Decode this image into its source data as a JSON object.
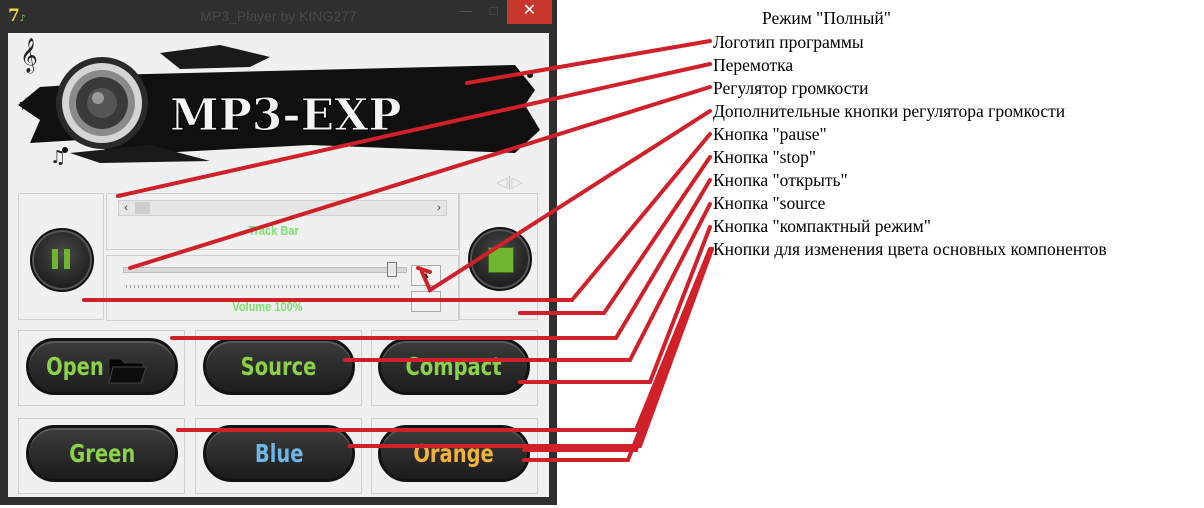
{
  "window": {
    "title": "MP3_Player by KING277",
    "app_icon_text": "7",
    "minimize": "—",
    "maximize": "□",
    "close": "✕"
  },
  "logo": {
    "text": "MP3-EXP"
  },
  "track": {
    "label": "Track Bar"
  },
  "volume": {
    "label": "Volume 100%",
    "level": 1.0
  },
  "buttons": {
    "open": "Open",
    "source": "Source",
    "compact": "Compact",
    "green": "Green",
    "blue": "Blue",
    "orange": "Orange"
  },
  "colors": {
    "green_label": "#8bd24a",
    "blue_label": "#6fb6e8",
    "orange_label": "#f2b33a",
    "annotation_line": "#d0202a"
  },
  "annotations": {
    "header": "Режим \"Полный\"",
    "items": [
      "Логотип программы",
      "Перемотка",
      "Регулятор громкости",
      "Дополнительные кнопки регулятора громкости",
      "Кнопка \"pause\"",
      "Кнопка \"stop\"",
      "Кнопка \"открыть\"",
      "Кнопка \"source",
      "Кнопка \"компактный режим\"",
      "Кнопки для изменения цвета основных компонентов"
    ]
  }
}
